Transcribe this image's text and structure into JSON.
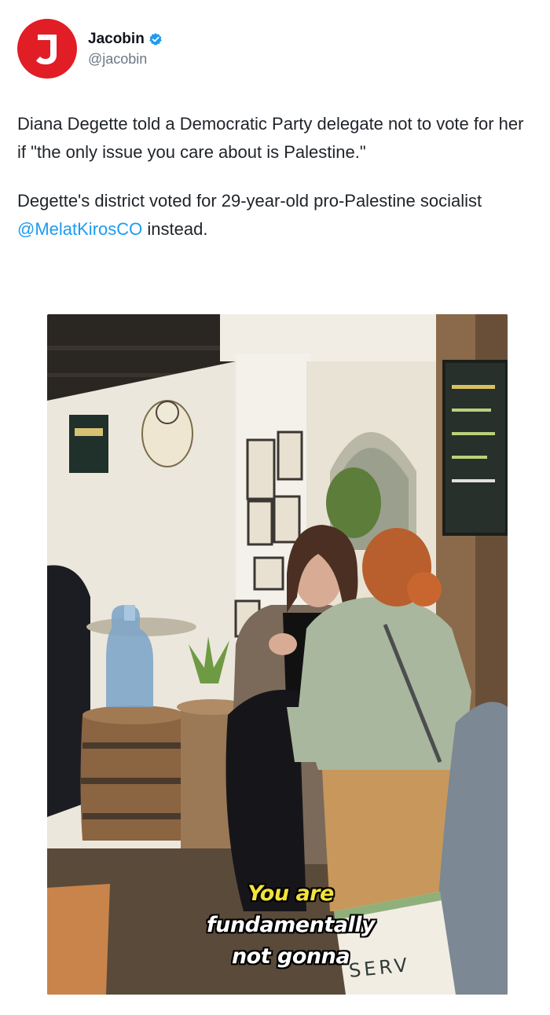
{
  "post": {
    "display_name": "Jacobin",
    "handle": "@jacobin",
    "avatar_letter": "J",
    "verified_icon": "verified-badge-icon",
    "paragraph1": "Diana Degette told a Democratic Party delegate not to vote for her if \"the only issue you care about is Palestine.\"",
    "paragraph2_before": "Degette's district voted for 29-year-old pro-Palestine socialist ",
    "paragraph2_mention": "@MelatKirosCO",
    "paragraph2_after": " instead."
  },
  "photo": {
    "caption_line1": "You are",
    "caption_line2": "fundamentally",
    "caption_line3": "not gonna",
    "sign_text": "SERV"
  },
  "colors": {
    "avatar_red": "#e11d26",
    "verified_blue": "#1d9bf0",
    "mention_blue": "#1d9bf0",
    "caption_yellow": "#f3e23a"
  }
}
